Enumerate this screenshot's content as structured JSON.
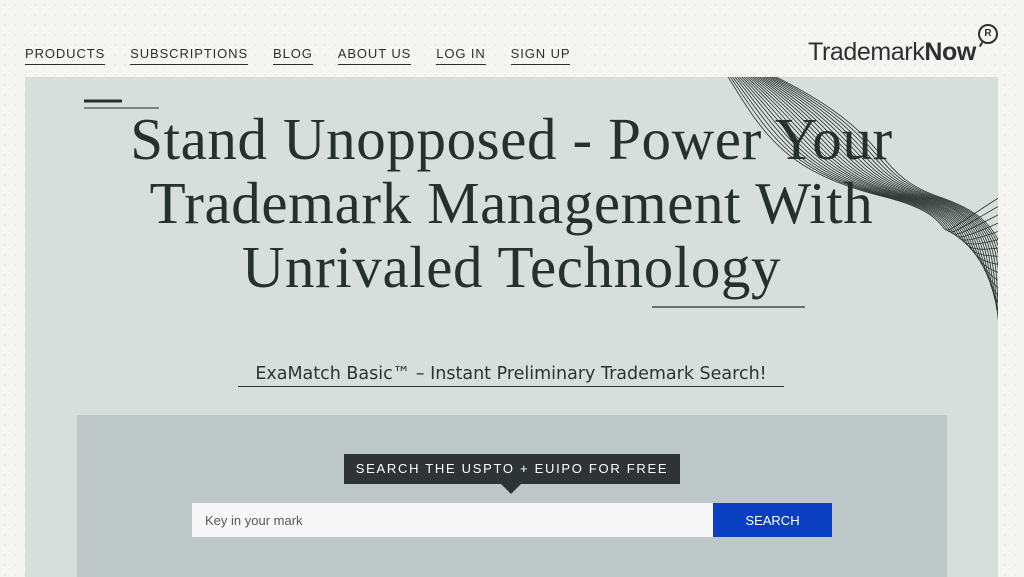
{
  "nav": {
    "items": [
      "PRODUCTS",
      "SUBSCRIPTIONS",
      "BLOG",
      "ABOUT US",
      "LOG IN",
      "SIGN UP"
    ]
  },
  "logo": {
    "text_regular": "Trademark",
    "text_bold": "Now",
    "reg_mark": "R"
  },
  "hero": {
    "headline_line1": "Stand Unopposed - Power Your",
    "headline_line2": "Trademark Management With",
    "headline_line3": "Unrivaled Technology",
    "subtitle": "ExaMatch Basic™ – Instant Preliminary Trademark Search!"
  },
  "search": {
    "tooltip": "SEARCH THE USPTO + EUIPO FOR FREE",
    "placeholder": "Key in your mark",
    "button_label": "SEARCH"
  },
  "colors": {
    "hero_bg": "#d7dedb",
    "panel_bg": "#bfc8c9",
    "button_blue": "#0a3fc1",
    "tooltip_bg": "#2e3433",
    "text_dark": "#26302d"
  }
}
